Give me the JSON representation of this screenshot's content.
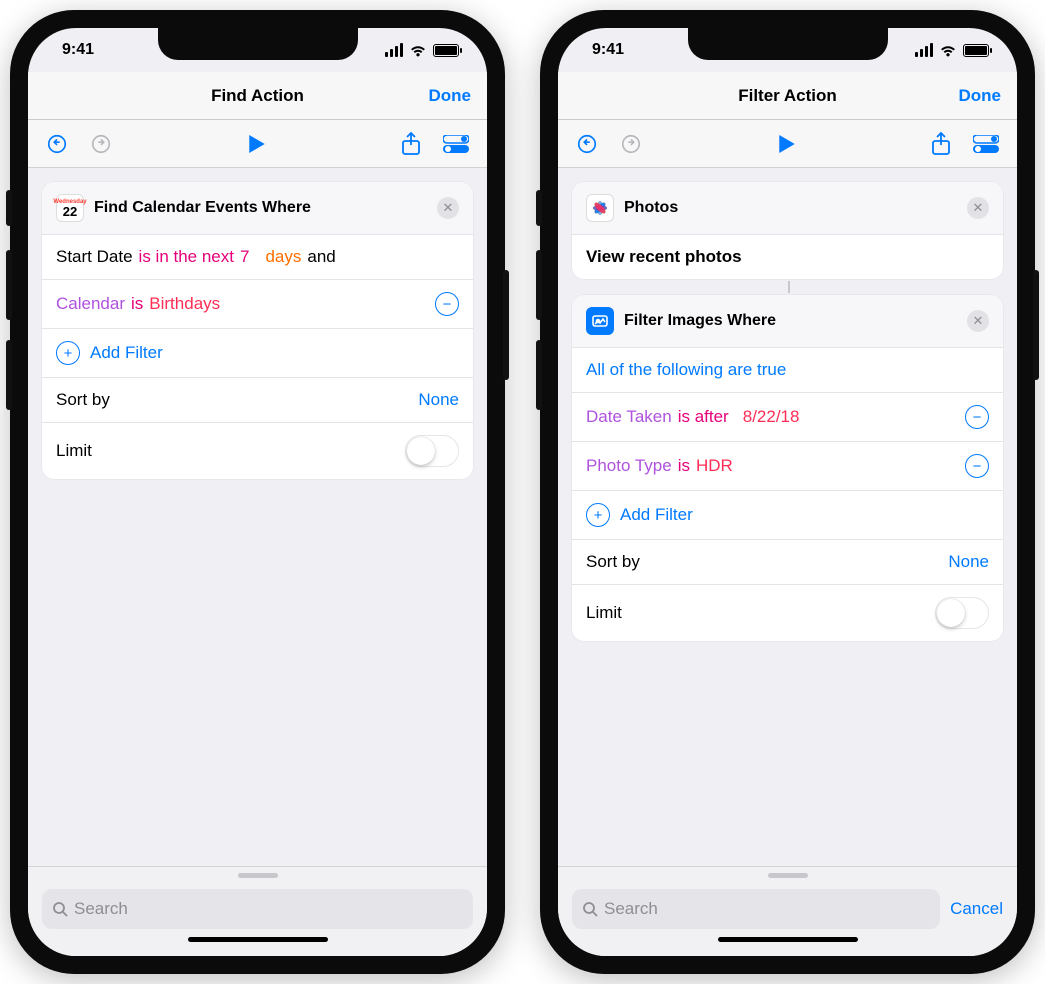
{
  "status": {
    "time": "9:41"
  },
  "colors": {
    "accent": "#007aff",
    "pink": "#e6007a",
    "purple": "#af52de",
    "orange": "#ff6d00",
    "red": "#ff2d55"
  },
  "left": {
    "nav": {
      "title": "Find Action",
      "done": "Done"
    },
    "card": {
      "icon": {
        "top": "Wednesday",
        "day": "22"
      },
      "title": "Find Calendar Events Where",
      "row1": {
        "prefix": "Start Date",
        "op": "is in the next",
        "val1": "7",
        "val2": "days",
        "suffix": "and"
      },
      "row2": {
        "field": "Calendar",
        "op": "is",
        "value": "Birthdays"
      },
      "add": "Add Filter",
      "sort_label": "Sort by",
      "sort_value": "None",
      "limit_label": "Limit",
      "limit_on": false
    },
    "search": {
      "placeholder": "Search",
      "cancel": null
    }
  },
  "right": {
    "nav": {
      "title": "Filter Action",
      "done": "Done"
    },
    "photos_card": {
      "title": "Photos",
      "subtitle": "View recent photos"
    },
    "filter_card": {
      "title": "Filter Images Where",
      "scope": "All of the following are true",
      "row1": {
        "field": "Date Taken",
        "op": "is after",
        "value": "8/22/18"
      },
      "row2": {
        "field": "Photo Type",
        "op": "is",
        "value": "HDR"
      },
      "add": "Add Filter",
      "sort_label": "Sort by",
      "sort_value": "None",
      "limit_label": "Limit",
      "limit_on": false
    },
    "search": {
      "placeholder": "Search",
      "cancel": "Cancel"
    }
  }
}
